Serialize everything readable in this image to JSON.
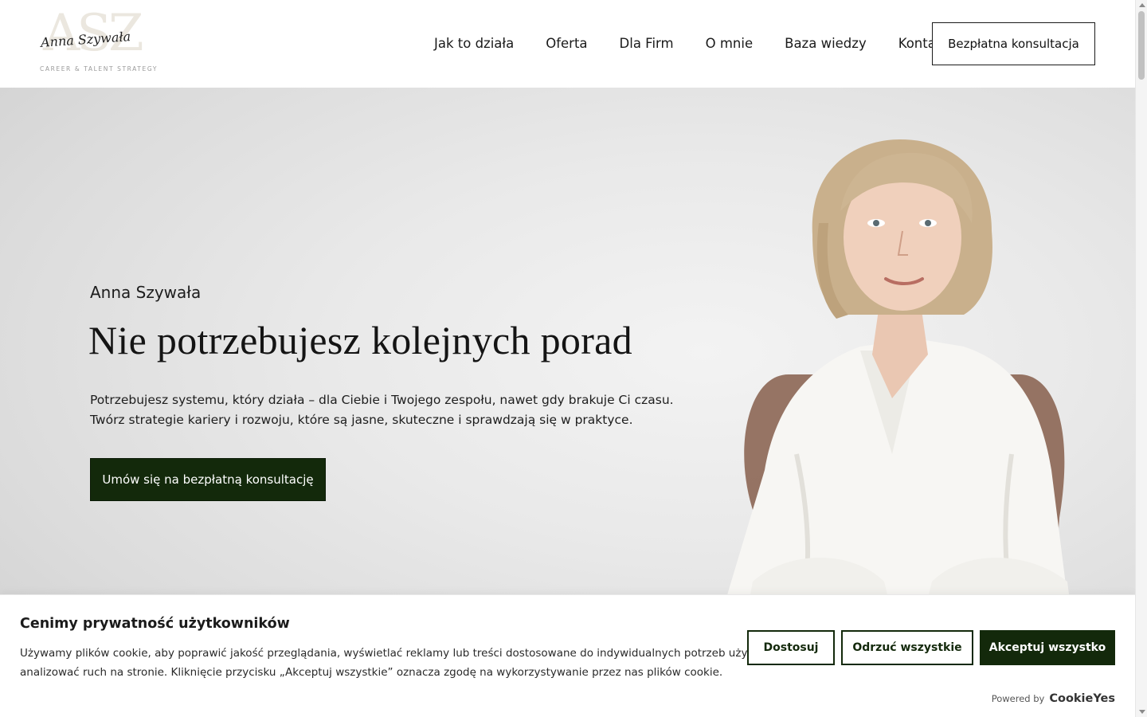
{
  "header": {
    "logo": {
      "monogram": "ASZ",
      "script_name": "Anna Szywała",
      "tagline": "CAREER & TALENT STRATEGY"
    },
    "nav": [
      {
        "label": "Jak to działa"
      },
      {
        "label": "Oferta"
      },
      {
        "label": "Dla Firm"
      },
      {
        "label": "O mnie"
      },
      {
        "label": "Baza wiedzy"
      },
      {
        "label": "Kontakt"
      }
    ],
    "cta_label": "Bezpłatna konsultacja"
  },
  "hero": {
    "name": "Anna Szywała",
    "title": "Nie potrzebujesz kolejnych porad",
    "text_line1": "Potrzebujesz systemu, który działa – dla Ciebie i Twojego zespołu, nawet gdy brakuje Ci czasu.",
    "text_line2": "Twórz strategie kariery i rozwoju, które są jasne, skuteczne i sprawdzają się w praktyce.",
    "cta_label": "Umów się na bezpłatną konsultację"
  },
  "cookie": {
    "title": "Cenimy prywatność użytkowników",
    "text_line1": "Używamy plików cookie, aby poprawić jakość przeglądania, wyświetlać reklamy lub treści dostosowane do indywidualnych potrzeb użytkowników oraz",
    "text_line2": "analizować ruch na stronie. Kliknięcie przycisku „Akceptuj wszystkie” oznacza zgodę na wykorzystywanie przez nas plików cookie.",
    "customize_label": "Dostosuj",
    "reject_label": "Odrzuć wszystkie",
    "accept_label": "Akceptuj wszystko",
    "powered_by": "Powered by",
    "powered_brand": "CookieYes"
  },
  "colors": {
    "accent_dark_green": "#13290b",
    "hero_background": "#e6e6e6",
    "text": "#141414"
  },
  "icons": [
    "scrollbar-up-arrow-icon",
    "scrollbar-down-arrow-icon"
  ]
}
